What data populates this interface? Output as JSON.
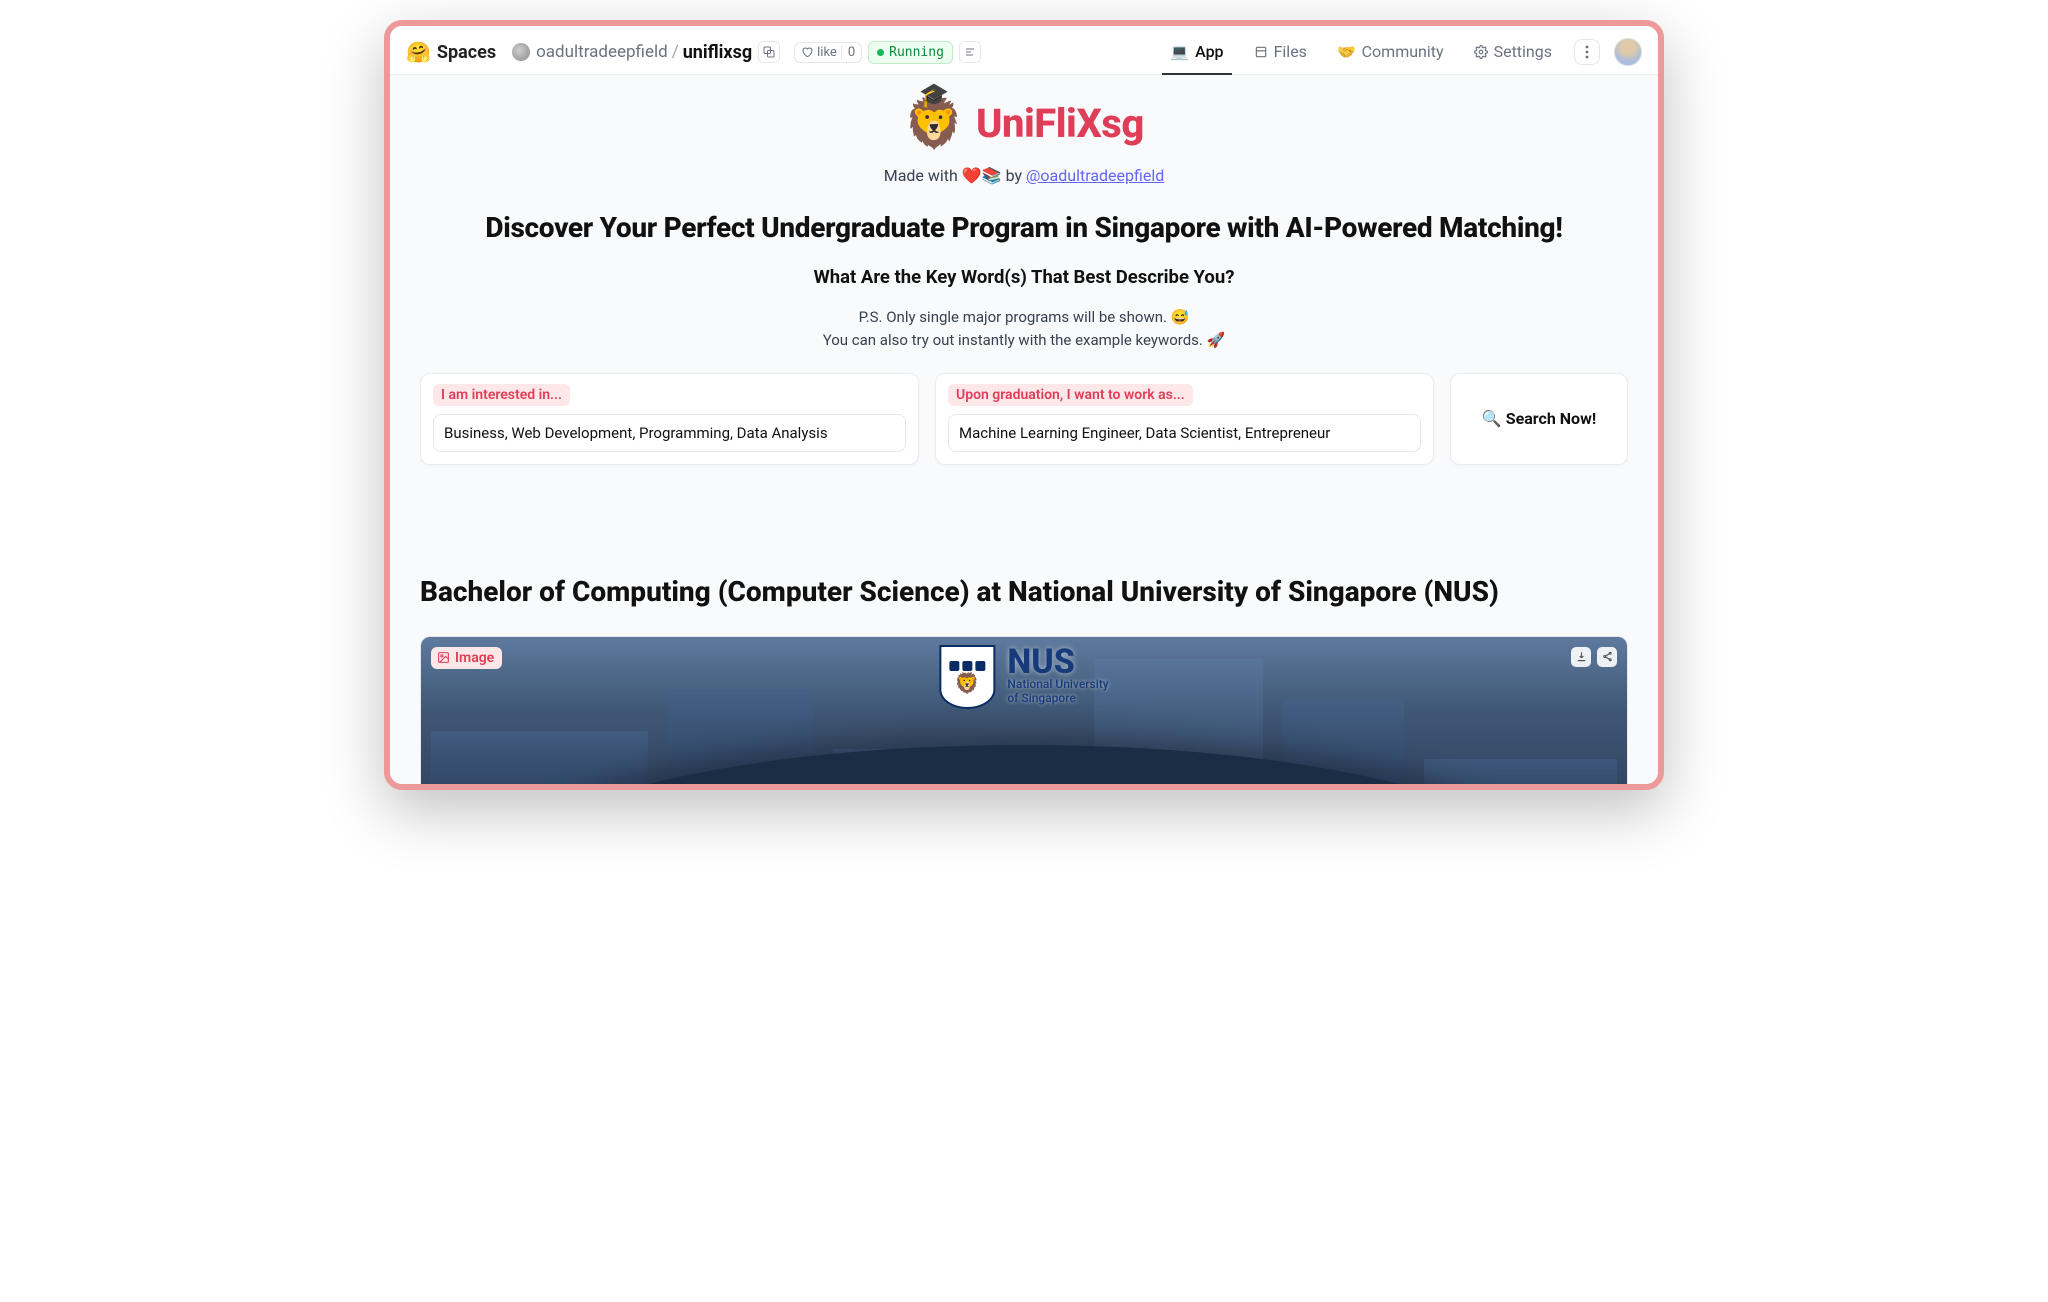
{
  "header": {
    "spaces_label": "Spaces",
    "owner": "oadultradeepfield",
    "repo": "uniflixsg",
    "like_label": "like",
    "like_count": "0",
    "status": "Running"
  },
  "nav": {
    "app": "App",
    "files": "Files",
    "community": "Community",
    "settings": "Settings"
  },
  "hero": {
    "title": "UniFliXsg",
    "made_prefix": "Made with ",
    "made_emoji": "❤️📚",
    "made_by": " by ",
    "author_handle": "@oadultradeepfield",
    "tagline": "Discover Your Perfect Undergraduate Program in Singapore with AI-Powered Matching!",
    "question": "What Are the Key Word(s) That Best Describe You?",
    "hint_line1": "P.S. Only single major programs will be shown. 😅",
    "hint_line2": "You can also try out instantly with the example keywords. 🚀"
  },
  "fields": {
    "interest_label": "I am interested in...",
    "interest_value": "Business, Web Development, Programming, Data Analysis",
    "career_label": "Upon graduation, I want to work as...",
    "career_value": "Machine Learning Engineer, Data Scientist, Entrepreneur",
    "search_label": "🔍 Search Now!"
  },
  "result": {
    "title": "Bachelor of Computing (Computer Science) at National University of Singapore (NUS)",
    "image_tag": "Image",
    "logo_big": "NUS",
    "logo_small1": "National University",
    "logo_small2": "of Singapore"
  }
}
